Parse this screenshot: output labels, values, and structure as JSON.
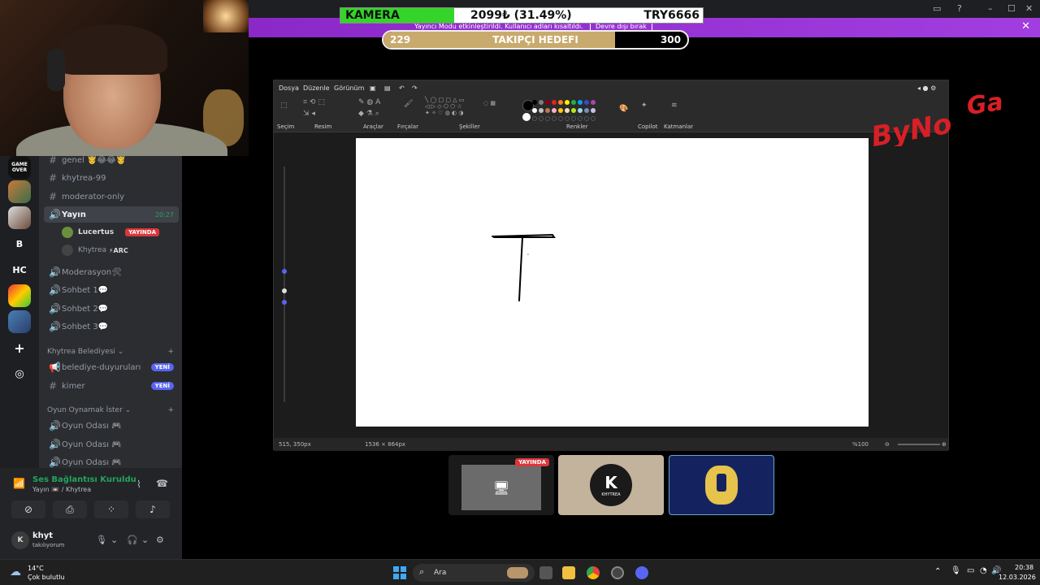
{
  "overlay": {
    "kamera_label": "KAMERA",
    "kamera_value": "2099₺ (31.49%)",
    "kamera_goal": "TRY6666",
    "kamera_progress_fraction": 0.3149,
    "takipci_current": "229",
    "takipci_title": "TAKIPÇI HEDEFI",
    "takipci_target": "300",
    "takipci_progress_fraction": 0.763
  },
  "notice": {
    "message": "Yayıncı Modu etkinleştirildi. Kullanıcı adları kısaltıldı.",
    "disable_label": "Devre dışı bırak"
  },
  "guilds": [
    "GAME OVER",
    "B",
    "HC"
  ],
  "channels": {
    "items": [
      {
        "label": "genel 🤴😂😂🤴",
        "sym": "#"
      },
      {
        "label": "khytrea-99",
        "sym": "#"
      },
      {
        "label": "moderator-only",
        "sym": "#"
      },
      {
        "label": "Yayın",
        "sym": "🔊",
        "time": "20:27"
      },
      {
        "label": "Moderasyon🛠",
        "sym": "🔊"
      },
      {
        "label": "Sohbet 1💬",
        "sym": "🔊"
      },
      {
        "label": "Sohbet 2💬",
        "sym": "🔊"
      },
      {
        "label": "Sohbet 3💬",
        "sym": "🔊"
      }
    ],
    "voice_users": [
      {
        "name": "Lucertus",
        "badge": "YAYINDA"
      },
      {
        "name": "Khytrea",
        "extra": "⚡ARC"
      }
    ],
    "category1": "Khytrea Belediyesi",
    "cat1_items": [
      {
        "label": "belediye-duyuruları",
        "badge": "YENİ"
      },
      {
        "label": "kimer",
        "badge": "YENİ"
      }
    ],
    "category2": "Oyun Oynamak İster",
    "cat2_items": [
      "Oyun Odası 🎮",
      "Oyun Odası 🎮",
      "Oyun Odası 🎮"
    ]
  },
  "voice_panel": {
    "title": "Ses Bağlantısı Kuruldu",
    "subtitle": "Yayın 📼 / Khytrea"
  },
  "user": {
    "name": "khyt",
    "status": "takılıyorum"
  },
  "paint": {
    "menu": [
      "Dosya",
      "Düzenle",
      "Görünüm"
    ],
    "groups": [
      "Seçim",
      "Resim",
      "Araçlar",
      "Fırçalar",
      "Şekiller",
      "Renkler",
      "Copilot",
      "Katmanlar"
    ],
    "status_pos": "515, 350px",
    "status_size": "1536 × 864px",
    "zoom": "%100"
  },
  "thumbs": {
    "live_badge": "YAYINDA",
    "khytrea_label": "KHYTREA"
  },
  "taskbar": {
    "weather_temp": "14°C",
    "weather_desc": "Çok bulutlu",
    "search_placeholder": "Ara",
    "time": "20:38",
    "date": "12.03.2026"
  },
  "colors": {
    "discord_bg": "#2b2d31",
    "accent_purple": "#a23ddf",
    "kamera_green": "#35d42a",
    "takipci_gold": "#c9aa6d",
    "live_red": "#da373c"
  }
}
